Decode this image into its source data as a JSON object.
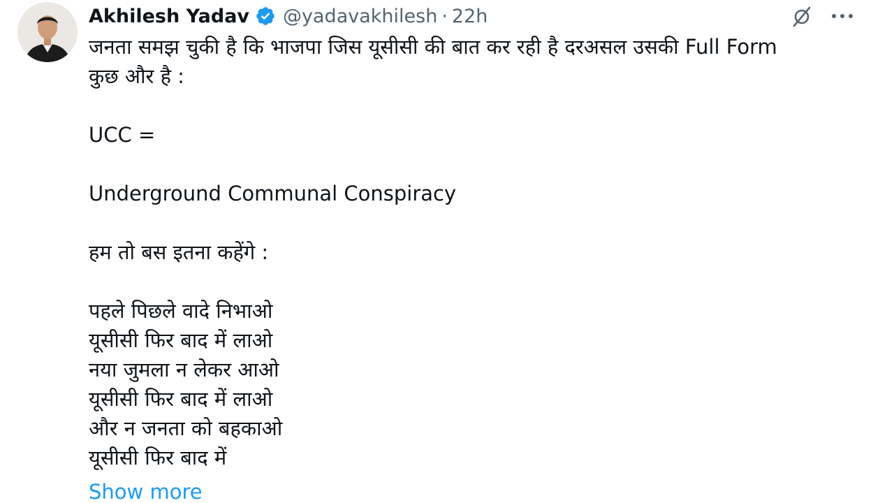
{
  "author": {
    "name": "Akhilesh Yadav",
    "handle": "@yadavakhilesh",
    "separator": "·",
    "time": "22h"
  },
  "icons": {
    "verified": "verified-badge-icon",
    "grok": "grok-icon",
    "more": "more-options-icon",
    "verified_color": "#1d9bf0"
  },
  "tweet": {
    "l1": "जनता समझ चुकी है कि भाजपा जिस यूसीसी की बात कर रही है दरअसल उसकी Full Form",
    "l2": "कुछ और है :",
    "l3": "UCC =",
    "l4": "Underground Communal Conspiracy",
    "l5": "हम तो बस इतना कहेंगे :",
    "l6": "पहले पिछले वादे निभाओ",
    "l7": "यूसीसी फिर बाद में लाओ",
    "l8": "नया जुमला न लेकर आओ",
    "l9": "यूसीसी फिर बाद में लाओ",
    "l10": "और न जनता को बहकाओ",
    "l11": "यूसीसी फिर बाद में",
    "show_more": "Show more"
  }
}
